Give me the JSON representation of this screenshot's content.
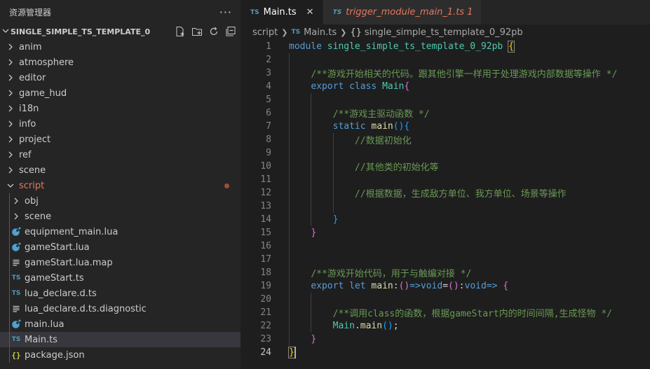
{
  "explorer": {
    "title": "资源管理器",
    "more_icon": "ellipsis-icon",
    "root_label": "SINGLE_SIMPLE_TS_TEMPLATE_0",
    "actions": [
      "new-file-icon",
      "new-folder-icon",
      "refresh-icon",
      "collapse-all-icon"
    ],
    "items": [
      {
        "label": "anim",
        "type": "folder"
      },
      {
        "label": "atmosphere",
        "type": "folder"
      },
      {
        "label": "editor",
        "type": "folder"
      },
      {
        "label": "game_hud",
        "type": "folder"
      },
      {
        "label": "i18n",
        "type": "folder"
      },
      {
        "label": "info",
        "type": "folder"
      },
      {
        "label": "project",
        "type": "folder"
      },
      {
        "label": "ref",
        "type": "folder"
      },
      {
        "label": "scene",
        "type": "folder"
      },
      {
        "label": "script",
        "type": "folder-open",
        "modified": true
      }
    ],
    "script_children": [
      {
        "label": "obj",
        "type": "folder"
      },
      {
        "label": "scene",
        "type": "folder"
      },
      {
        "label": "equipment_main.lua",
        "type": "lua"
      },
      {
        "label": "gameStart.lua",
        "type": "lua"
      },
      {
        "label": "gameStart.lua.map",
        "type": "text"
      },
      {
        "label": "gameStart.ts",
        "type": "ts"
      },
      {
        "label": "lua_declare.d.ts",
        "type": "ts"
      },
      {
        "label": "lua_declare.d.ts.diagnostic",
        "type": "text"
      },
      {
        "label": "main.lua",
        "type": "lua"
      },
      {
        "label": "Main.ts",
        "type": "ts",
        "selected": true
      },
      {
        "label": "package.json",
        "type": "json"
      }
    ]
  },
  "tabs": [
    {
      "label": "Main.ts",
      "active": true,
      "icon": "TS"
    },
    {
      "label": "trigger_module_main_1.ts",
      "badge": "1",
      "active": false,
      "icon": "TS"
    }
  ],
  "breadcrumb": {
    "folder": "script",
    "file": "Main.ts",
    "symbol": "single_simple_ts_template_0_92pb",
    "symbol_icon": "{}"
  },
  "editor": {
    "current_line": 24,
    "lines": [
      [
        [
          "kw",
          "module"
        ],
        [
          "op",
          " "
        ],
        [
          "ns",
          "single_simple_ts_template_0_92pb"
        ],
        [
          "op",
          " "
        ],
        [
          "br1",
          "{"
        ]
      ],
      [],
      [
        [
          "op",
          "    "
        ],
        [
          "cm",
          "/**游戏开始相关的代码。跟其他引擎一样用于处理游戏内部数据等操作 */"
        ]
      ],
      [
        [
          "op",
          "    "
        ],
        [
          "kw",
          "export"
        ],
        [
          "op",
          " "
        ],
        [
          "kw",
          "class"
        ],
        [
          "op",
          " "
        ],
        [
          "cls",
          "Main"
        ],
        [
          "br2",
          "{"
        ]
      ],
      [],
      [
        [
          "op",
          "        "
        ],
        [
          "cm",
          "/**游戏主驱动函数 */"
        ]
      ],
      [
        [
          "op",
          "        "
        ],
        [
          "kw",
          "static"
        ],
        [
          "op",
          " "
        ],
        [
          "fn",
          "main"
        ],
        [
          "br3",
          "()"
        ],
        [
          "br3",
          "{"
        ]
      ],
      [
        [
          "op",
          "            "
        ],
        [
          "cm",
          "//数据初始化"
        ]
      ],
      [],
      [
        [
          "op",
          "            "
        ],
        [
          "cm",
          "//其他类的初始化等"
        ]
      ],
      [],
      [
        [
          "op",
          "            "
        ],
        [
          "cm",
          "//根据数据，生成敌方单位、我方单位、场景等操作"
        ]
      ],
      [],
      [
        [
          "op",
          "        "
        ],
        [
          "br3",
          "}"
        ]
      ],
      [
        [
          "op",
          "    "
        ],
        [
          "br2",
          "}"
        ]
      ],
      [],
      [],
      [
        [
          "op",
          "    "
        ],
        [
          "cm",
          "/**游戏开始代码，用于与触编对接 */"
        ]
      ],
      [
        [
          "op",
          "    "
        ],
        [
          "kw",
          "export"
        ],
        [
          "op",
          " "
        ],
        [
          "kw",
          "let"
        ],
        [
          "op",
          " "
        ],
        [
          "fn",
          "main"
        ],
        [
          "op",
          ":"
        ],
        [
          "br2",
          "()"
        ],
        [
          "kw",
          "=>"
        ],
        [
          "kw",
          "void"
        ],
        [
          "op",
          "="
        ],
        [
          "br2",
          "()"
        ],
        [
          "op",
          ":"
        ],
        [
          "kw",
          "void"
        ],
        [
          "kw",
          "=>"
        ],
        [
          "op",
          " "
        ],
        [
          "br2",
          "{"
        ]
      ],
      [],
      [
        [
          "op",
          "        "
        ],
        [
          "cm",
          "/**调用class的函数，根据gameStart内的时间间隔,生成怪物 */"
        ]
      ],
      [
        [
          "op",
          "        "
        ],
        [
          "cls",
          "Main"
        ],
        [
          "op",
          "."
        ],
        [
          "fn",
          "main"
        ],
        [
          "br3",
          "()"
        ],
        [
          "op",
          ";"
        ]
      ],
      [
        [
          "op",
          "    "
        ],
        [
          "br2",
          "}"
        ]
      ],
      [
        [
          "br1",
          "}"
        ]
      ]
    ]
  }
}
